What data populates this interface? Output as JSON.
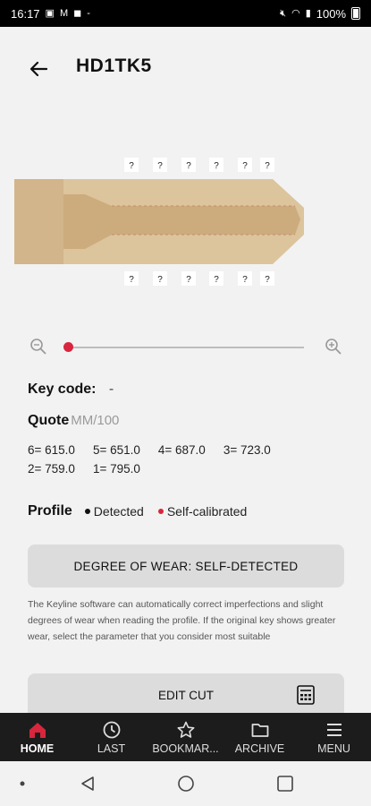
{
  "status_bar": {
    "time": "16:17",
    "battery": "100%"
  },
  "header": {
    "title": "HD1TK5"
  },
  "key_markers": {
    "top": [
      "?",
      "?",
      "?",
      "?",
      "?",
      "?"
    ],
    "bottom": [
      "?",
      "?",
      "?",
      "?",
      "?",
      "?"
    ]
  },
  "key_code": {
    "label": "Key code:",
    "value": "-"
  },
  "quote": {
    "label": "Quote",
    "unit": "MM/100",
    "values": [
      "6= 615.0",
      "5= 651.0",
      "4= 687.0",
      "3= 723.0",
      "2= 759.0",
      "1= 795.0"
    ]
  },
  "zoom": {
    "level": 0
  },
  "profile": {
    "label": "Profile",
    "detected": "Detected",
    "self_calibrated": "Self-calibrated",
    "detected_color": "#111111",
    "self_calibrated_color": "#d7263d"
  },
  "wear_button": {
    "label": "DEGREE OF WEAR: SELF-DETECTED"
  },
  "info": {
    "text": "The Keyline software can automatically correct imperfections and slight degrees of wear when reading the profile.  If the original key shows greater wear, select the parameter that you consider most suitable"
  },
  "edit_button": {
    "label": "EDIT CUT"
  },
  "nav": {
    "items": [
      {
        "label": "HOME",
        "icon": "home-icon",
        "active": true
      },
      {
        "label": "LAST",
        "icon": "clock-icon"
      },
      {
        "label": "BOOKMAR...",
        "icon": "star-icon"
      },
      {
        "label": "ARCHIVE",
        "icon": "folder-icon"
      },
      {
        "label": "MENU",
        "icon": "menu-icon"
      }
    ]
  },
  "colors": {
    "accent": "#d7263d",
    "key_body": "#d2b58a",
    "nav_bg": "#1c1c1c"
  }
}
